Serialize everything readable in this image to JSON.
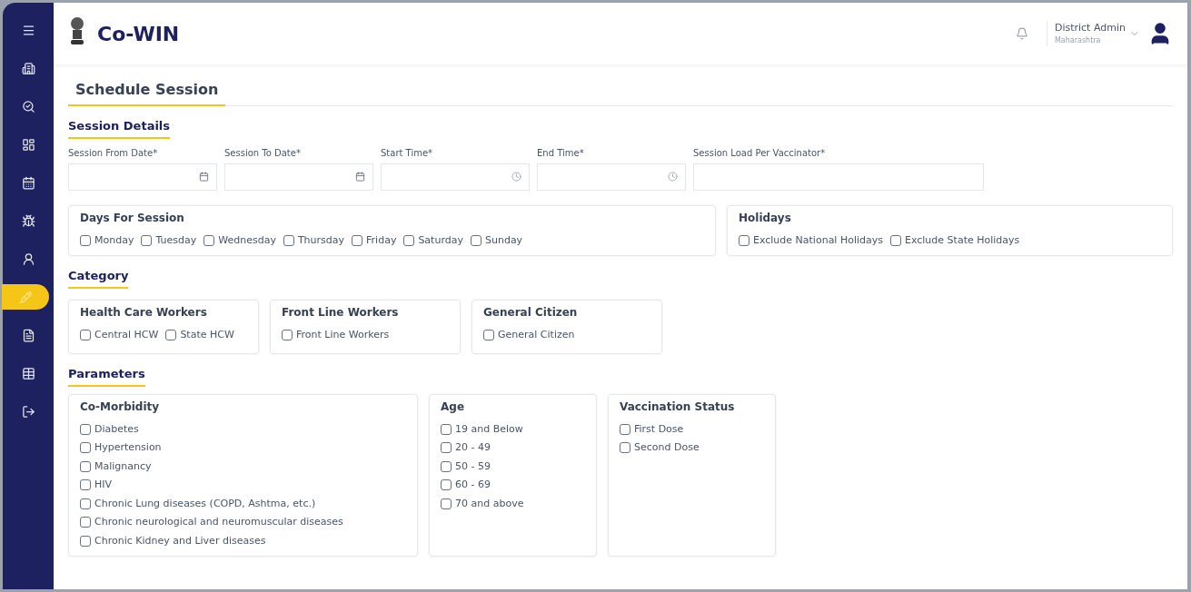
{
  "sidebar": {
    "items": [
      {
        "kind": "menu",
        "selected": false
      },
      {
        "kind": "home",
        "selected": false
      },
      {
        "kind": "search",
        "selected": false
      },
      {
        "kind": "dashboard",
        "selected": false
      },
      {
        "kind": "calendar",
        "selected": false
      },
      {
        "kind": "virus",
        "selected": false
      },
      {
        "kind": "user",
        "selected": false
      },
      {
        "kind": "session",
        "selected": true
      },
      {
        "kind": "file",
        "selected": false
      },
      {
        "kind": "table",
        "selected": false
      },
      {
        "kind": "logout",
        "selected": false
      }
    ]
  },
  "header": {
    "logo_text": "Co-WIN",
    "user_name": "District Admin",
    "user_subtitle": "Maharashtra"
  },
  "page_title": "Schedule Session",
  "session_details": {
    "title": "Session Details",
    "fields": [
      {
        "label": "Session From Date*",
        "kind": "date"
      },
      {
        "label": "Session To Date*",
        "kind": "date"
      },
      {
        "label": "Start Time*",
        "kind": "time"
      },
      {
        "label": "End Time*",
        "kind": "time"
      },
      {
        "label": "Session Load Per Vaccinator*",
        "kind": "text"
      }
    ]
  },
  "days_for_session": {
    "title": "Days For Session",
    "options": [
      {
        "label": "Monday",
        "checked": false
      },
      {
        "label": "Tuesday",
        "checked": false
      },
      {
        "label": "Wednesday",
        "checked": false
      },
      {
        "label": "Thursday",
        "checked": false
      },
      {
        "label": "Friday",
        "checked": false
      },
      {
        "label": "Saturday",
        "checked": false
      },
      {
        "label": "Sunday",
        "checked": false
      }
    ]
  },
  "holidays": {
    "title": "Holidays",
    "options": [
      {
        "label": "Exclude National Holidays",
        "checked": false
      },
      {
        "label": "Exclude State Holidays",
        "checked": false
      }
    ]
  },
  "category": {
    "title": "Category",
    "groups": [
      {
        "title": "Health Care Workers",
        "options": [
          {
            "label": "Central HCW",
            "checked": false
          },
          {
            "label": "State HCW",
            "checked": false
          }
        ]
      },
      {
        "title": "Front Line Workers",
        "options": [
          {
            "label": "Front Line Workers",
            "checked": false
          }
        ]
      },
      {
        "title": "General Citizen",
        "options": [
          {
            "label": "General Citizen",
            "checked": false
          }
        ]
      }
    ]
  },
  "parameters": {
    "title": "Parameters",
    "groups": [
      {
        "title": "Co-Morbidity",
        "options": [
          {
            "label": "Diabetes",
            "checked": false
          },
          {
            "label": "Hypertension",
            "checked": false
          },
          {
            "label": "Malignancy",
            "checked": false
          },
          {
            "label": "HIV",
            "checked": false
          },
          {
            "label": "Chronic Lung diseases (COPD, Ashtma, etc.)",
            "checked": false
          },
          {
            "label": "Chronic neurological and neuromuscular diseases",
            "checked": false
          },
          {
            "label": "Chronic Kidney and Liver diseases",
            "checked": false
          }
        ]
      },
      {
        "title": "Age",
        "options": [
          {
            "label": "19 and Below",
            "checked": false
          },
          {
            "label": "20 - 49",
            "checked": false
          },
          {
            "label": "50 - 59",
            "checked": false
          },
          {
            "label": "60 - 69",
            "checked": false
          },
          {
            "label": "70 and above",
            "checked": false
          }
        ]
      },
      {
        "title": "Vaccination Status",
        "options": [
          {
            "label": "First Dose",
            "checked": false
          },
          {
            "label": "Second Dose",
            "checked": false
          }
        ]
      }
    ]
  }
}
